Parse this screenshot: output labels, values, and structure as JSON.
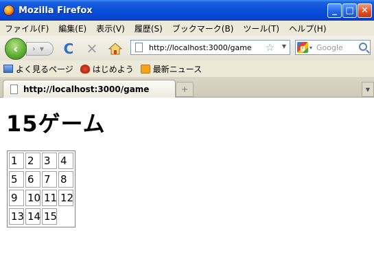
{
  "window": {
    "title": "Mozilla Firefox",
    "controls": {
      "minimize": "_",
      "maximize": "□",
      "close": "✕"
    }
  },
  "menu": [
    "ファイル(F)",
    "編集(E)",
    "表示(V)",
    "履歴(S)",
    "ブックマーク(B)",
    "ツール(T)",
    "ヘルプ(H)"
  ],
  "nav": {
    "back_glyph": "‹",
    "forward_glyph": "›",
    "reload_glyph": "C",
    "stop_glyph": "✕",
    "url": "http://localhost:3000/game",
    "star_glyph": "☆",
    "search_placeholder": "Google"
  },
  "bookmarks": [
    "よく見るページ",
    "はじめよう",
    "最新ニュース"
  ],
  "tabs": [
    {
      "label": "http://localhost:3000/game",
      "active": true
    }
  ],
  "newtab_glyph": "+",
  "page": {
    "heading": "15ゲーム",
    "board": [
      "1",
      "2",
      "3",
      "4",
      "5",
      "6",
      "7",
      "8",
      "9",
      "10",
      "11",
      "12",
      "13",
      "14",
      "15",
      ""
    ]
  },
  "icons": {
    "logo": "firefox-logo-icon",
    "home": "home-icon",
    "search": "magnifier-icon",
    "rss": "rss-icon"
  },
  "colors": {
    "titlebar": "#0a4fd8",
    "back_button": "#61b033",
    "reload": "#2a6fd6"
  }
}
